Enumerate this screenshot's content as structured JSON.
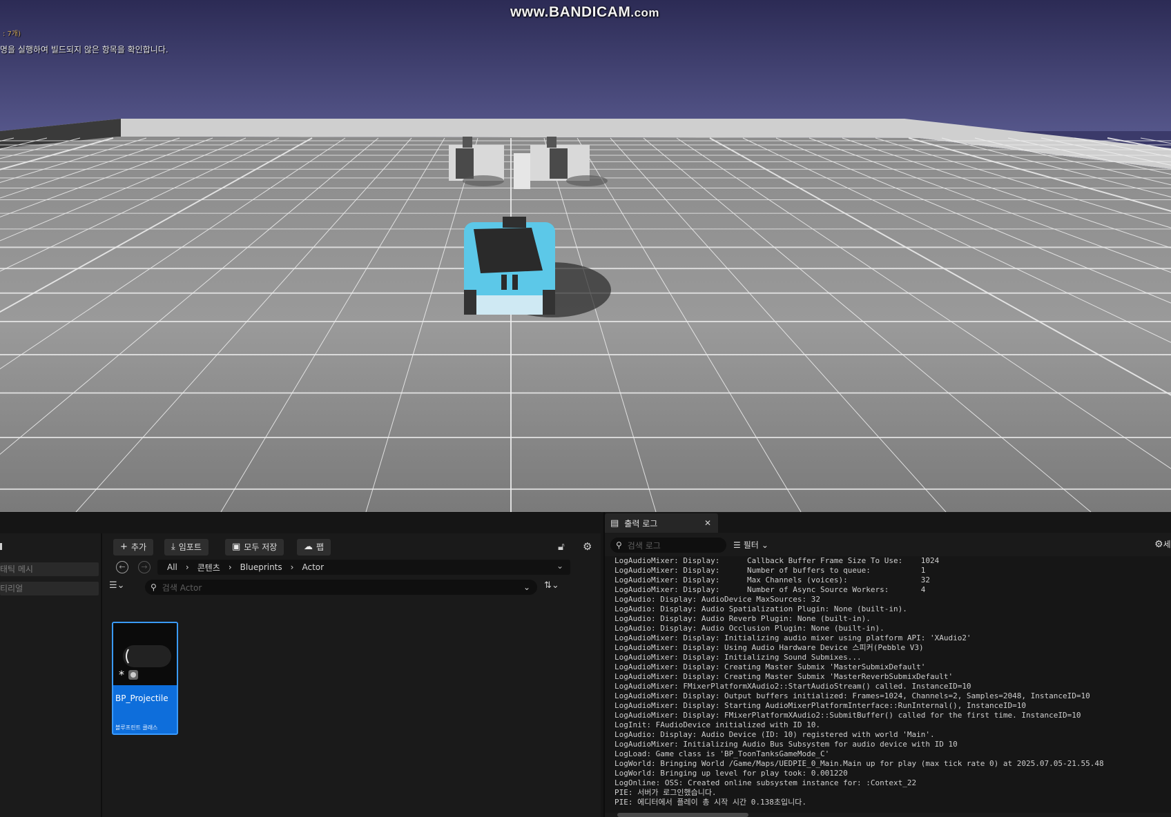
{
  "watermark": {
    "main": "www.BANDICAM",
    "suffix": ".com"
  },
  "viewport": {
    "note_count": ": 7개)",
    "note_message": "명을 실행하여 빌드되지 않은 항목을 확인합니다."
  },
  "content_browser": {
    "sidebar_items": [
      "태틱 메시",
      "티리얼"
    ],
    "toolbar": {
      "add_label": "추가",
      "import_label": "임포트",
      "save_all_label": "모두 저장",
      "fab_label": "팹"
    },
    "breadcrumb": [
      "All",
      "콘텐츠",
      "Blueprints",
      "Actor"
    ],
    "search_placeholder": "검색 Actor",
    "assets": [
      {
        "name": "BP_Projectile",
        "type": "블루프린트 클래스"
      }
    ]
  },
  "output_log": {
    "tab_label": "출력 로그",
    "search_placeholder": "검색 로그",
    "filter_label": "필터",
    "settings_label": "세",
    "lines": [
      "LogAudioMixer: Display:      Callback Buffer Frame Size To Use:    1024",
      "LogAudioMixer: Display:      Number of buffers to queue:           1",
      "LogAudioMixer: Display:      Max Channels (voices):                32",
      "LogAudioMixer: Display:      Number of Async Source Workers:       4",
      "LogAudio: Display: AudioDevice MaxSources: 32",
      "LogAudio: Display: Audio Spatialization Plugin: None (built-in).",
      "LogAudio: Display: Audio Reverb Plugin: None (built-in).",
      "LogAudio: Display: Audio Occlusion Plugin: None (built-in).",
      "LogAudioMixer: Display: Initializing audio mixer using platform API: 'XAudio2'",
      "LogAudioMixer: Display: Using Audio Hardware Device 스피커(Pebble V3)",
      "LogAudioMixer: Display: Initializing Sound Submixes...",
      "LogAudioMixer: Display: Creating Master Submix 'MasterSubmixDefault'",
      "LogAudioMixer: Display: Creating Master Submix 'MasterReverbSubmixDefault'",
      "LogAudioMixer: FMixerPlatformXAudio2::StartAudioStream() called. InstanceID=10",
      "LogAudioMixer: Display: Output buffers initialized: Frames=1024, Channels=2, Samples=2048, InstanceID=10",
      "LogAudioMixer: Display: Starting AudioMixerPlatformInterface::RunInternal(), InstanceID=10",
      "LogAudioMixer: Display: FMixerPlatformXAudio2::SubmitBuffer() called for the first time. InstanceID=10",
      "LogInit: FAudioDevice initialized with ID 10.",
      "LogAudio: Display: Audio Device (ID: 10) registered with world 'Main'.",
      "LogAudioMixer: Initializing Audio Bus Subsystem for audio device with ID 10",
      "LogLoad: Game class is 'BP_ToonTanksGameMode_C'",
      "LogWorld: Bringing World /Game/Maps/UEDPIE_0_Main.Main up for play (max tick rate 0) at 2025.07.05-21.55.48",
      "LogWorld: Bringing up level for play took: 0.001220",
      "LogOnline: OSS: Created online subsystem instance for: :Context_22",
      "PIE: 서버가 로그인했습니다.",
      "PIE: 에디터에서 플레이 총 시작 시간 0.138초입니다."
    ]
  }
}
